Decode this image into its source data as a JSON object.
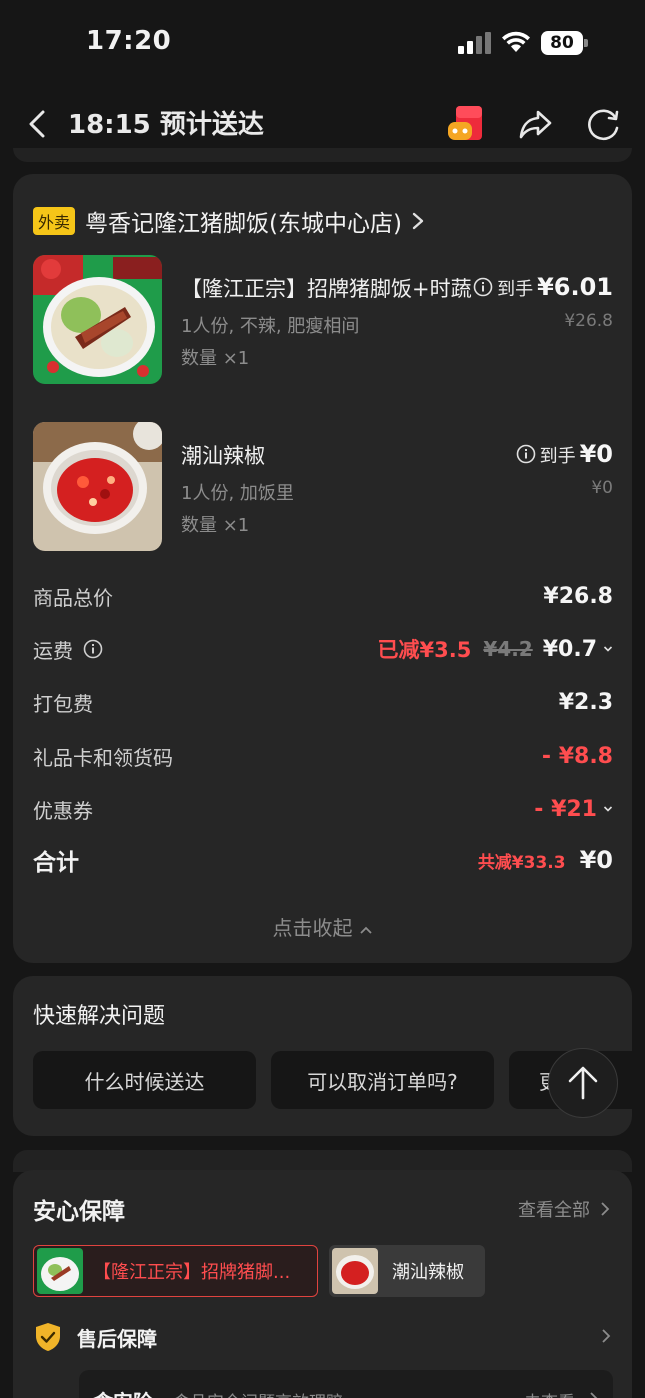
{
  "status_bar": {
    "time": "17:20",
    "battery": "80"
  },
  "nav": {
    "title": "18:15 预计送达",
    "icons": [
      "back-icon",
      "red-packet-icon",
      "share-icon",
      "refresh-icon"
    ]
  },
  "order": {
    "store_tag": "外卖",
    "store_name": "粤香记隆江猪脚饭(东城中心店)",
    "items": [
      {
        "name": "【隆江正宗】招牌猪脚饭+时蔬",
        "spec": "1人份, 不辣, 肥瘦相间",
        "qty": "数量 ×1",
        "price_label": "到手",
        "price": "¥6.01",
        "original_price": "¥26.8"
      },
      {
        "name": "潮汕辣椒",
        "spec": "1人份, 加饭里",
        "qty": "数量 ×1",
        "price_label": "到手",
        "price": "¥0",
        "original_price": "¥0"
      }
    ],
    "fees": {
      "subtotal_label": "商品总价",
      "subtotal_value": "¥26.8",
      "delivery_label": "运费",
      "delivery_reduced": "已减¥3.5",
      "delivery_original": "¥4.2",
      "delivery_value": "¥0.7",
      "packing_label": "打包费",
      "packing_value": "¥2.3",
      "giftcard_label": "礼品卡和领货码",
      "giftcard_value": "- ¥8.8",
      "coupon_label": "优惠券",
      "coupon_value": "- ¥21",
      "total_label": "合计",
      "total_saved": "共减¥33.3",
      "total_value": "¥0"
    },
    "collapse_label": "点击收起"
  },
  "quick_solve": {
    "title": "快速解决问题",
    "chips": [
      "什么时候送达",
      "可以取消订单吗?",
      "更多"
    ]
  },
  "guarantee": {
    "title": "安心保障",
    "view_all": "查看全部",
    "tabs": [
      "【隆江正宗】招牌猪脚...",
      "潮汕辣椒"
    ],
    "after_sales_label": "售后保障",
    "food_safety_title": "食安险",
    "food_safety_desc": "食品安全问题高效理赔",
    "food_safety_action": "去查看"
  },
  "colors": {
    "background": "#161616",
    "card": "#262626",
    "accent_red": "#ff4d4f",
    "tag_yellow": "#f5c518"
  }
}
